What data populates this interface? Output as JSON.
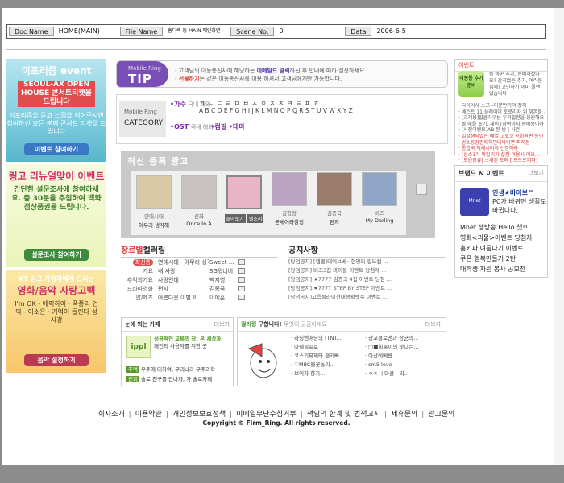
{
  "header": {
    "doc_label": "Doc Name",
    "doc_value": "HOME(MAIN)",
    "file_label": "File  Name",
    "file_value": "홈디렉 등 MAIN 메인화면",
    "scene_label": "Scene No.",
    "scene_value": "0",
    "data_label": "Data",
    "data_value": "2006-6-5"
  },
  "left_ads": [
    {
      "t1": "이포리즘 event",
      "t2": "SEOUL-AX OPEN HOUSE 콘서트티켓을 드립니다",
      "body": "이포리즘을 듣고 느낌을 적어주시면 참여하신 모든 분께 콘서트 티켓을 드립니다",
      "btn": "이벤트 참여하기",
      "btn_color": "#3a78c3"
    },
    {
      "t1": "링고 리뉴얼맞이 이벤트",
      "t2": "간단한 설문조사에 참여하세요. 총 30분을 추첨하여 백화점상품권을 드립니다.",
      "body": "",
      "btn": "설문조사 참여하기",
      "btn_color": "#3d8a3a"
    },
    {
      "t1": "KT 링고 가입자에게 드리는",
      "t2": "영화/음악 사랑고백",
      "body": "I'm OK - 에픽하이 · 폭풍의 언덕 - 이소은 · 기억이 들린다 성시경",
      "btn": "음악 설정하기",
      "btn_color": "#b93b52"
    }
  ],
  "tip": {
    "badge_small": "Mobile Ring",
    "badge": "TIP",
    "line1_a": "- 고객님의 이동통신사에 해당하는 ",
    "line1_b": "에메랄드 클릭",
    "line1_c": "하신 후 안내에 따라 설정하세요.",
    "line2_a": "- ",
    "line2_b": "선물하기",
    "line2_c": "는 같은 이동통신사를 이용 하셔서 고객님에게만 가능합니다."
  },
  "category": {
    "small": "Mobile Ring",
    "title": "CATEGORY",
    "singer_key": "•가수",
    "singer_sub": "국내 해외",
    "letters_kr": "ㄱ ㄴ ㄷ ㄹ ㅁ ㅂ ㅅ ㅇ ㅈ ㅊ ㅋ ㅌ ㅍ ㅎ",
    "letters_en": "A B C D E F G H I J K L M N O P Q R S T U V W X Y Z",
    "ost_key": "•OST",
    "ost_sub": "국내 해외",
    "genre": "•컴필  •테마"
  },
  "new_release": {
    "title": "최신 등록 광고",
    "items": [
      {
        "artist": "연애시대",
        "song": "이우리 생각해",
        "color": "#d9c9a6"
      },
      {
        "artist": "신화",
        "song": "Once In A",
        "color": "#c8c3c0"
      },
      {
        "artist": "",
        "song": "",
        "selected": true,
        "btn1": "들어보기",
        "btn2": "벨소리",
        "color": "#e9b4c6"
      },
      {
        "artist": "김형정",
        "song": "굳세어라항정",
        "color": "#bba3c3"
      },
      {
        "artist": "김종국",
        "song": "편지",
        "color": "#9a7c6a"
      },
      {
        "artist": "버즈",
        "song": "My Darling",
        "color": "#8fa6c9"
      }
    ]
  },
  "chart": {
    "title_a": "장르별",
    "title_b": "컬러링",
    "rows": [
      {
        "genre": "최신통",
        "song": "연애시대 - 아무리 생각...",
        "artist": "Sweet ..."
      },
      {
        "genre": "가요",
        "song": "내 사랑",
        "artist": "SG워너비"
      },
      {
        "genre": "추억의가요",
        "song": "사랑인데",
        "artist": "박지영"
      },
      {
        "genre": "드라마영화",
        "song": "편지",
        "artist": "김종국"
      },
      {
        "genre": "팝/제즈",
        "song": "아름다운 이별 II",
        "artist": "이예훈"
      }
    ]
  },
  "notice": {
    "title": "공지사항",
    "rows": [
      "[당첨공지] [캡콤]테이브베~현영의 필드컵 ...",
      "[당첨공지] 버즈3집 마이블 이벤트 당첨자 ...",
      "[당첨공지] ★7777 김종국 4집 이벤트 당첨 ...",
      "[당첨공지] ★7777 STEP BY STEP 이벤트 ...",
      "[당첨공지]고음블라이현대생활백수 이벤트 ..."
    ]
  },
  "cafe": {
    "title": "눈에 띄는 카페",
    "more": "더보기",
    "logo": "ippl",
    "desc_a": "성공적인 교류의 장, 온 세상과",
    "desc_b": "페인티 사용자를 위한 곳",
    "line1_a": "추억",
    "line1_b": "우주에 대하여, 우리나라 우주과학",
    "line2_a": "진피",
    "line2_b": "솔로 친구를 만나자, 가 솔로카페"
  },
  "recommend": {
    "title_a": "컬러링 ",
    "title_b": "구합니다!",
    "title_c": " 무엇이 궁금하세요",
    "more": "더보기",
    "left": [
      "· 라딩엔애딩의 [TNT...",
      "· 아쉐필프로",
      "· 코스기뮤제타 편키빠",
      "· ♡MBC불꽃놀이...",
      "· 보이차 향기..."
    ],
    "right": [
      "· 광교클로맨과 장군의...",
      "· □■힐룽이의 맛나는...",
      "· 아산레베싼",
      "· sm5 love",
      "· ㅇㅈ ㅣ마콜 - 리..."
    ]
  },
  "right_event": {
    "title": "이벤트",
    "box": "이동통 추가 준비",
    "desc": "좀 바꾼 추가, 준비하셨나요? 감곡없은 추가, 여러분 집에! 고민하기 이미 플랜없습니다",
    "lines": [
      "· 다이어사 소고~미분반기의 장지",
      "· 베스트 11 플레이어 토로리자 위 위본들 ~",
      "· [크레용]힙클라우는 우리힙전을 응원해요",
      "· 볼 애플 초기, 재이 [참여이지 준비중이아]",
      "· [사전이벤트]AB 된 방 | 사건",
      "· 일렬샘되었는 배열 고료코 공회원편 동민",
      "· 방소등장컨에하민대박이면 파지점",
      "· 통합국 액세서리의 선정하라",
      "· [선스1가 마일리지 설정 이용시 이요...",
      "· [모음당류] 소개된 토메 [ 모트르피파]"
    ]
  },
  "brand": {
    "title": "브랜드 & 이벤트",
    "more": "더보기",
    "logo": "Mnet",
    "desc_a": "인생★바이브™",
    "desc_b": "PC가 바뀌면 생활도 바뀝니다.",
    "list": [
      "Mnet 생방송 Hello 챗!!",
      "영화<괴물>이벤트 당첨자",
      "홈키파 여름나기 이벤트",
      "쿠폰 행복만들기 2탄",
      "대학생 자원 봉사 공모전"
    ]
  },
  "footer": {
    "links": [
      "회사소개",
      "이용약관",
      "개인정보보호정책",
      "이메일무단수집거부",
      "책임의 한계 및 법적고지",
      "제휴문의",
      "광고문의"
    ],
    "copyright": "Copyright © Firm_Ring.  All rights reserved."
  }
}
